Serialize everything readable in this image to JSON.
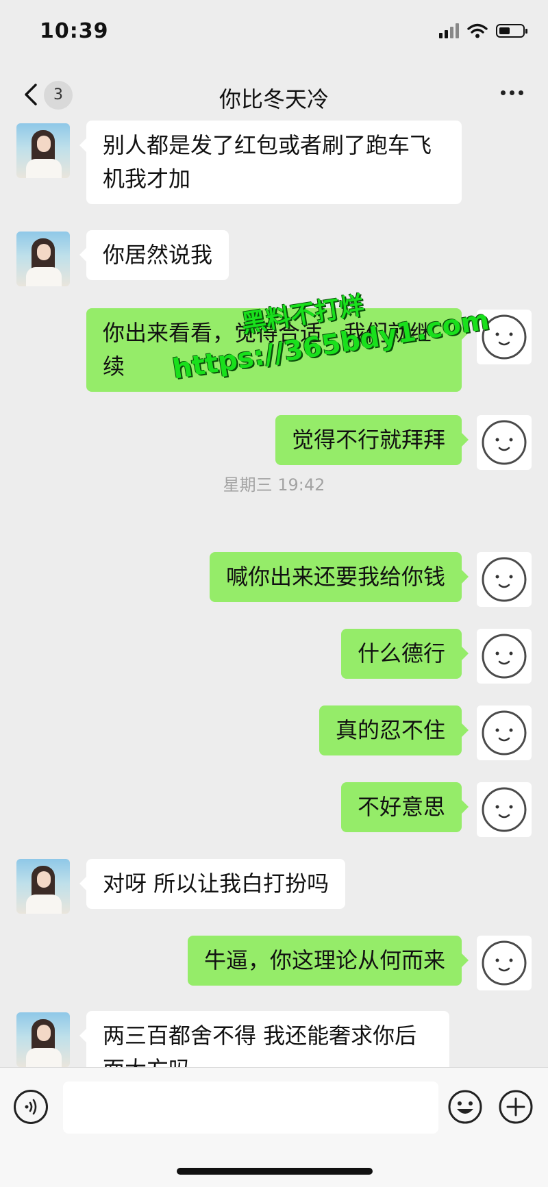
{
  "status_bar": {
    "time": "10:39"
  },
  "nav": {
    "back_badge": "3",
    "title": "你比冬天冷"
  },
  "watermark": {
    "line1": "黑料不打烊",
    "line2": "https://365bdy1.com"
  },
  "timestamp": "星期三 19:42",
  "messages": [
    {
      "side": "in",
      "text": "别人都是发了红包或者刷了跑车飞机我才加"
    },
    {
      "side": "in",
      "text": "你居然说我"
    },
    {
      "side": "out",
      "text": "你出来看看，觉得合适，我们就继续"
    },
    {
      "side": "out",
      "text": "觉得不行就拜拜"
    },
    {
      "side": "out",
      "text": "喊你出来还要我给你钱"
    },
    {
      "side": "out",
      "text": "什么德行"
    },
    {
      "side": "out",
      "text": "真的忍不住"
    },
    {
      "side": "out",
      "text": "不好意思"
    },
    {
      "side": "in",
      "text": "对呀  所以让我白打扮吗"
    },
    {
      "side": "out",
      "text": "牛逼，你这理论从何而来"
    },
    {
      "side": "in",
      "text": "两三百都舍不得  我还能奢求你后面大方吗"
    }
  ],
  "icons": {
    "back": "chevron-left-icon",
    "more": "more-dots-icon",
    "voice": "voice-icon",
    "emoji": "emoji-icon",
    "plus": "plus-icon"
  },
  "colors": {
    "background": "#ededed",
    "outgoing_bubble": "#95ec69",
    "incoming_bubble": "#ffffff"
  }
}
